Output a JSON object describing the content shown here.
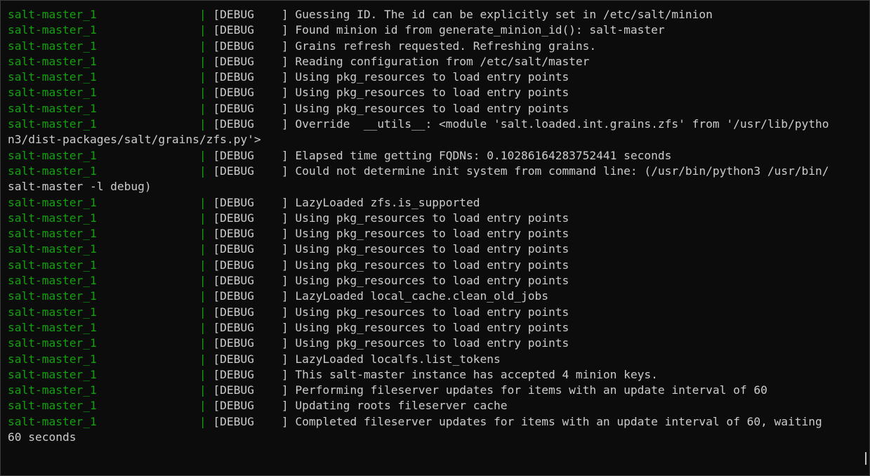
{
  "terminal": {
    "lines": [
      {
        "svc": "salt-master_1",
        "level": "DEBUG",
        "msg": "Guessing ID. The id can be explicitly set in /etc/salt/minion"
      },
      {
        "svc": "salt-master_1",
        "level": "DEBUG",
        "msg": "Found minion id from generate_minion_id(): salt-master"
      },
      {
        "svc": "salt-master_1",
        "level": "DEBUG",
        "msg": "Grains refresh requested. Refreshing grains."
      },
      {
        "svc": "salt-master_1",
        "level": "DEBUG",
        "msg": "Reading configuration from /etc/salt/master"
      },
      {
        "svc": "salt-master_1",
        "level": "DEBUG",
        "msg": "Using pkg_resources to load entry points"
      },
      {
        "svc": "salt-master_1",
        "level": "DEBUG",
        "msg": "Using pkg_resources to load entry points"
      },
      {
        "svc": "salt-master_1",
        "level": "DEBUG",
        "msg": "Using pkg_resources to load entry points"
      },
      {
        "svc": "salt-master_1",
        "level": "DEBUG",
        "msg": "Override  __utils__: <module 'salt.loaded.int.grains.zfs' from '/usr/lib/pytho"
      },
      {
        "wrap": "n3/dist-packages/salt/grains/zfs.py'>"
      },
      {
        "svc": "salt-master_1",
        "level": "DEBUG",
        "msg": "Elapsed time getting FQDNs: 0.10286164283752441 seconds"
      },
      {
        "svc": "salt-master_1",
        "level": "DEBUG",
        "msg": "Could not determine init system from command line: (/usr/bin/python3 /usr/bin/"
      },
      {
        "wrap": "salt-master -l debug)"
      },
      {
        "svc": "salt-master_1",
        "level": "DEBUG",
        "msg": "LazyLoaded zfs.is_supported"
      },
      {
        "svc": "salt-master_1",
        "level": "DEBUG",
        "msg": "Using pkg_resources to load entry points"
      },
      {
        "svc": "salt-master_1",
        "level": "DEBUG",
        "msg": "Using pkg_resources to load entry points"
      },
      {
        "svc": "salt-master_1",
        "level": "DEBUG",
        "msg": "Using pkg_resources to load entry points"
      },
      {
        "svc": "salt-master_1",
        "level": "DEBUG",
        "msg": "Using pkg_resources to load entry points"
      },
      {
        "svc": "salt-master_1",
        "level": "DEBUG",
        "msg": "Using pkg_resources to load entry points"
      },
      {
        "svc": "salt-master_1",
        "level": "DEBUG",
        "msg": "LazyLoaded local_cache.clean_old_jobs"
      },
      {
        "svc": "salt-master_1",
        "level": "DEBUG",
        "msg": "Using pkg_resources to load entry points"
      },
      {
        "svc": "salt-master_1",
        "level": "DEBUG",
        "msg": "Using pkg_resources to load entry points"
      },
      {
        "svc": "salt-master_1",
        "level": "DEBUG",
        "msg": "Using pkg_resources to load entry points"
      },
      {
        "svc": "salt-master_1",
        "level": "DEBUG",
        "msg": "LazyLoaded localfs.list_tokens"
      },
      {
        "svc": "salt-master_1",
        "level": "DEBUG",
        "msg": "This salt-master instance has accepted 4 minion keys."
      },
      {
        "svc": "salt-master_1",
        "level": "DEBUG",
        "msg": "Performing fileserver updates for items with an update interval of 60"
      },
      {
        "svc": "salt-master_1",
        "level": "DEBUG",
        "msg": "Updating roots fileserver cache"
      },
      {
        "svc": "salt-master_1",
        "level": "DEBUG",
        "msg": "Completed fileserver updates for items with an update interval of 60, waiting"
      },
      {
        "wrap": "60 seconds"
      }
    ]
  },
  "colors": {
    "background": "#0c0c0c",
    "service_name": "#13a10e",
    "text": "#cccccc"
  }
}
